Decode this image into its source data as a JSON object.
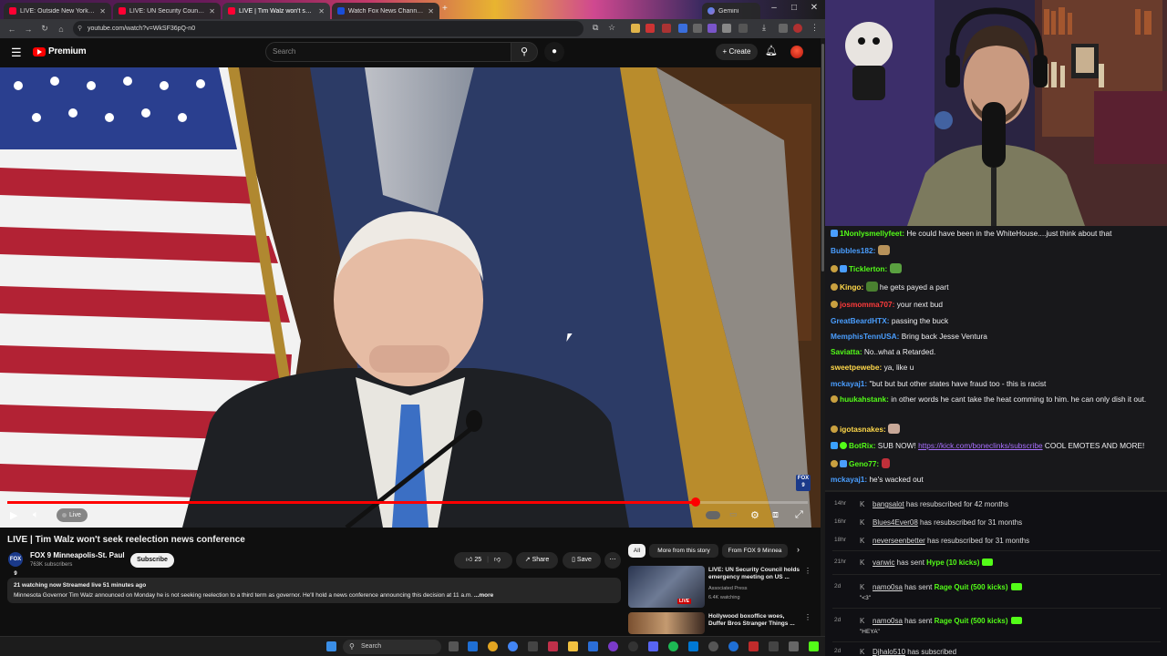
{
  "browser": {
    "tabs": [
      {
        "label": "LIVE: Outside New York co",
        "favicon": "youtube"
      },
      {
        "label": "LIVE: UN Security Council hold",
        "favicon": "youtube"
      },
      {
        "label": "LIVE | Tim Walz won't seek",
        "favicon": "youtube"
      },
      {
        "label": "Watch Fox News Channel O",
        "favicon": "fox"
      },
      {
        "label": "Gemini",
        "favicon": "gemini"
      }
    ],
    "new_tab_label": "+",
    "url": "youtube.com/watch?v=WkSF36pQ-n0"
  },
  "youtube": {
    "logo_text": "Premium",
    "search_placeholder": "Search",
    "create_label": "Create",
    "video": {
      "title": "LIVE | Tim Walz won't seek reelection news conference",
      "live_label": "Live",
      "progress": 0.86,
      "channel_logo_text": "FOX 9",
      "channel_name": "FOX 9 Minneapolis-St. Paul",
      "subscribers": "763K subscribers",
      "subscribe_label": "Subscribe",
      "likes": "25",
      "share_label": "Share",
      "save_label": "Save",
      "description_meta": "21 watching now  Streamed live 51 minutes ago",
      "description_text": "Minnesota Governor Tim Walz announced on Monday he is not seeking reelection to a third term as governor. He'll hold a news conference announcing this decision at 11 a.m.",
      "description_more": "...more"
    },
    "chips": [
      "All",
      "More from this story",
      "From FOX 9 Minnea"
    ],
    "related": [
      {
        "title": "LIVE: UN Security Council holds emergency meeting on US ...",
        "channel": "Associated Press",
        "meta": "6.4K watching",
        "badge": "LIVE"
      },
      {
        "title": "Hollywood boxoffice woes, Duffer Bros Stranger Things ...",
        "channel": "",
        "meta": "",
        "badge": ""
      }
    ]
  },
  "taskbar": {
    "search_label": "Search"
  },
  "chat": {
    "messages": [
      {
        "user": "1Nonlysmellyfeet:",
        "color": "#53fc18",
        "text": " He could have been in the WhiteHouse....just think about that"
      },
      {
        "user": "Bubbles182:",
        "color": "#4a9eff",
        "text": "",
        "emote": "emote-cat"
      },
      {
        "user": "Ticklerton:",
        "color": "#53fc18",
        "text": "",
        "emote": "emote-frog"
      },
      {
        "user": "Kingo:",
        "color": "#ffd84a",
        "text": " he gets payed a part",
        "emote_before": "emote-sunglasses"
      },
      {
        "user": "josmomma707:",
        "color": "#ff3b3b",
        "text": " your next bud"
      },
      {
        "user": "GreatBeardHTX:",
        "color": "#4a9eff",
        "text": " passing the buck"
      },
      {
        "user": "MemphisTennUSA:",
        "color": "#4a9eff",
        "text": " Bring back Jesse Ventura"
      },
      {
        "user": "Saviatta:",
        "color": "#53fc18",
        "text": " No..what a Retarded."
      },
      {
        "user": "sweetpewebe:",
        "color": "#ffd84a",
        "text": " ya, like u"
      },
      {
        "user": "mckayaj1:",
        "color": "#4a9eff",
        "text": " \"but but but other states have fraud too - this is racist"
      },
      {
        "user": "huukahstank:",
        "color": "#53fc18",
        "text": " in other words he cant take the heat comming to him. he can only dish it out."
      },
      {
        "user": "igotasnakes:",
        "color": "#ffd84a",
        "text": "",
        "emote": "emote-cat2"
      },
      {
        "user": "BotRix:",
        "color": "#53fc18",
        "text": " SUB NOW! ",
        "link": "https://kick.com/boneclinks/subscribe",
        "text_after": " COOL EMOTES AND MORE!"
      },
      {
        "user": "Geno77:",
        "color": "#53fc18",
        "text": "",
        "emote": "emote-rose"
      },
      {
        "user": "mckayaj1:",
        "color": "#4a9eff",
        "text": " he's wacked out"
      }
    ]
  },
  "events": [
    {
      "time": "14hr",
      "user": "bangsalot",
      "text": " has resubscribed for 42 months"
    },
    {
      "time": "16hr",
      "user": "Blues4Ever08",
      "text": " has resubscribed for 31 months"
    },
    {
      "time": "18hr",
      "user": "neverseenbetter",
      "text": " has resubscribed for 31 months"
    },
    {
      "time": "21hr",
      "user": "vanwic",
      "text": " has sent ",
      "gift": "Hype (10 kicks)"
    },
    {
      "time": "2d",
      "user": "namo0sa",
      "text": " has sent ",
      "gift": "Rage Quit (500 kicks)",
      "note": "\"<3\""
    },
    {
      "time": "2d",
      "user": "namo0sa",
      "text": " has sent ",
      "gift": "Rage Quit (500 kicks)",
      "note": "\"HEYA\""
    },
    {
      "time": "2d",
      "user": "Djhalo510",
      "text": " has subscribed"
    }
  ],
  "colors": {
    "accent": "#ff0000",
    "kick_green": "#53fc18",
    "bg": "#0f0f0f",
    "chat_bg": "#18181b"
  }
}
